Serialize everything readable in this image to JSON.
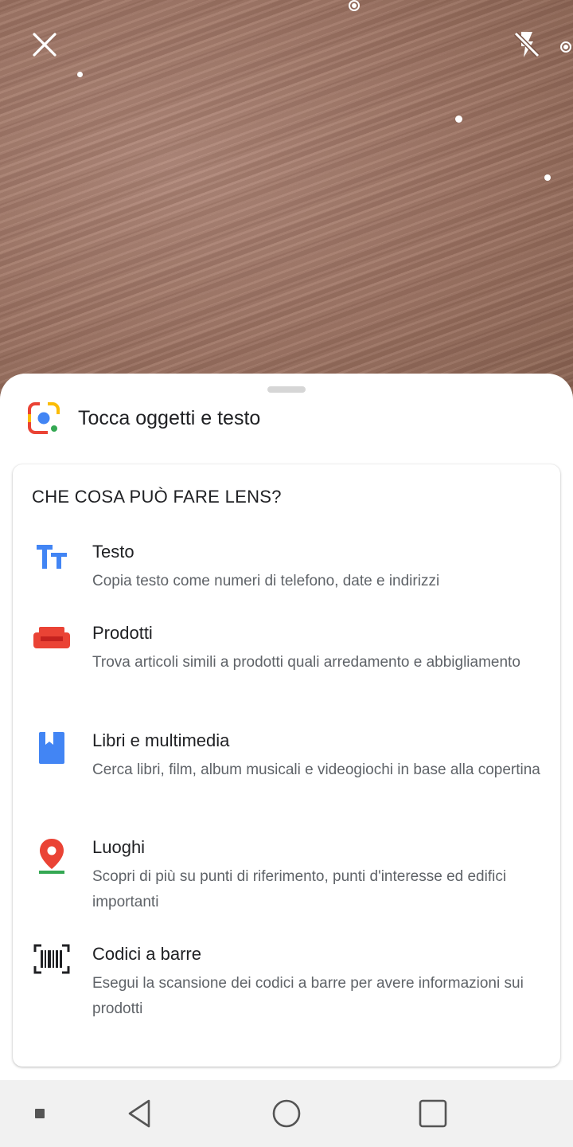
{
  "camera": {
    "close_icon": "close-icon",
    "flash_icon": "flash-off-icon"
  },
  "sheet": {
    "header_icon": "google-lens-icon",
    "title": "Tocca oggetti e testo"
  },
  "card": {
    "title": "CHE COSA PUÒ FARE LENS?",
    "features": [
      {
        "icon": "text-icon",
        "name": "Testo",
        "description": "Copia testo come numeri di telefono, date e indirizzi"
      },
      {
        "icon": "sofa-icon",
        "name": "Prodotti",
        "description": "Trova articoli simili a prodotti quali arredamento e abbigliamento"
      },
      {
        "icon": "book-icon",
        "name": "Libri e multimedia",
        "description": "Cerca libri, film, album musicali e videogiochi in base alla copertina"
      },
      {
        "icon": "place-icon",
        "name": "Luoghi",
        "description": "Scopri di più su punti di riferimento, punti d'interesse ed edifici importanti"
      },
      {
        "icon": "barcode-icon",
        "name": "Codici a barre",
        "description": "Esegui la scansione dei codici a barre per avere informazioni sui prodotti"
      }
    ]
  },
  "navbar": {
    "buttons": [
      "menu-icon",
      "back-icon",
      "home-icon",
      "recents-icon"
    ]
  },
  "colors": {
    "blue": "#4285f4",
    "red": "#ea4335",
    "yellow": "#fbbc04",
    "green": "#34a853"
  }
}
